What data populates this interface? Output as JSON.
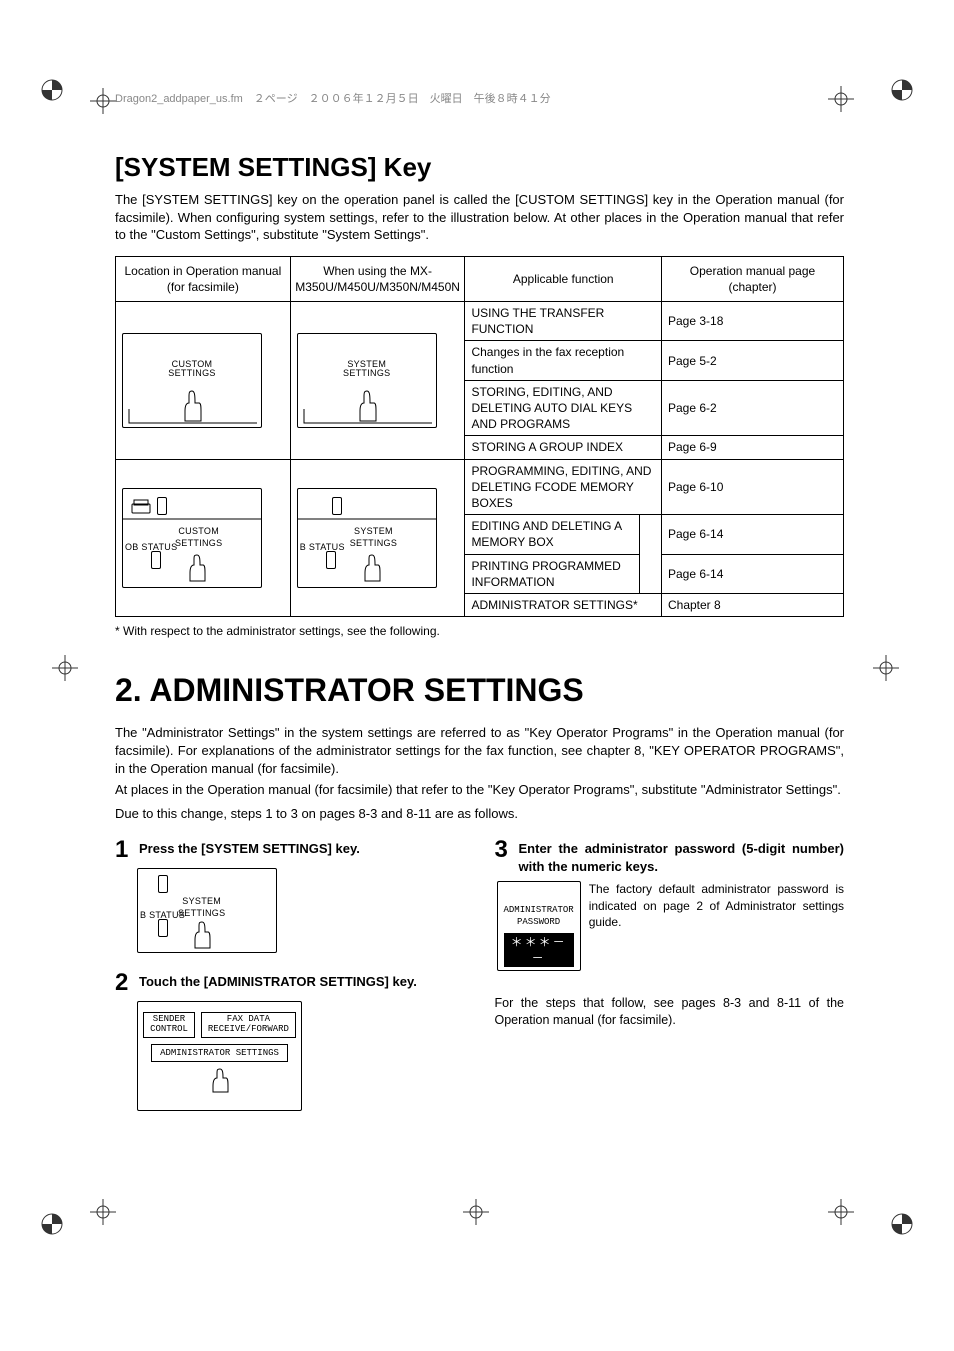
{
  "header_marker": "Dragon2_addpaper_us.fm　２ページ　２００６年１２月５日　火曜日　午後８時４１分",
  "section1": {
    "title": "[SYSTEM SETTINGS] Key",
    "body": "The [SYSTEM SETTINGS] key on the operation panel is called the [CUSTOM SETTINGS] key in the Operation manual (for facsimile). When configuring system settings, refer to the illustration below. At other places in the Operation manual that refer to the \"Custom Settings\", substitute \"System Settings\"."
  },
  "table": {
    "headers": [
      "Location in Operation manual (for facsimile)",
      "When using the MX-M350U/M450U/M350N/M450N",
      "Applicable function",
      "Operation manual page (chapter)"
    ],
    "col1_labels": {
      "top": "CUSTOM\nSETTINGS",
      "bottom_top": "CUSTOM",
      "bottom_sub": "SETTINGS",
      "edge": "OB STATUS"
    },
    "col2_labels": {
      "top": "SYSTEM\nSETTINGS",
      "bottom_top": "SYSTEM",
      "bottom_sub": "SETTINGS",
      "edge": "B STATUS"
    },
    "rows": [
      {
        "func": "USING THE TRANSFER FUNCTION",
        "page": "Page 3-18"
      },
      {
        "func": "Changes in the fax reception function",
        "page": "Page 5-2"
      },
      {
        "func": "STORING, EDITING, AND DELETING AUTO DIAL KEYS AND PROGRAMS",
        "page": "Page 6-2"
      },
      {
        "func": "STORING A GROUP INDEX",
        "page": "Page 6-9"
      },
      {
        "func": "PROGRAMMING, EDITING, AND DELETING FCODE MEMORY BOXES",
        "page": "Page 6-10"
      },
      {
        "func": "EDITING AND DELETING A MEMORY BOX",
        "page": "Page 6-14"
      },
      {
        "func": "PRINTING PROGRAMMED INFORMATION",
        "page": "Page 6-14"
      },
      {
        "func": "ADMINISTRATOR SETTINGS*",
        "page": "Chapter 8"
      }
    ],
    "footnote": "* With respect to the administrator settings, see the following."
  },
  "section2": {
    "title": "2. ADMINISTRATOR SETTINGS",
    "body1": "The \"Administrator Settings\" in the system settings are referred to as \"Key Operator Programs\" in the Operation manual (for facsimile). For explanations of the administrator settings for the fax function, see chapter 8, \"KEY OPERATOR PROGRAMS\", in the Operation manual (for facsimile).",
    "body2": "At places in the Operation manual (for facsimile) that refer to the \"Key Operator Programs\", substitute \"Administrator Settings\".",
    "body3": "Due to this change, steps 1 to 3 on pages 8-3 and 8-11 are as follows."
  },
  "steps": {
    "s1": {
      "num": "1",
      "text": "Press the [SYSTEM SETTINGS] key.",
      "illust_top": "SYSTEM",
      "illust_sub": "SETTINGS",
      "edge": "B STATUS"
    },
    "s2": {
      "num": "2",
      "text": "Touch the [ADMINISTRATOR SETTINGS] key.",
      "btn1": "SENDER CONTROL",
      "btn2_line1": "FAX DATA",
      "btn2_line2": "RECEIVE/FORWARD",
      "btn3": "ADMINISTRATOR SETTINGS"
    },
    "s3": {
      "num": "3",
      "text": "Enter the administrator password (5-digit number) with the numeric keys.",
      "pwd_label": "ADMINISTRATOR PASSWORD",
      "pwd_value": "＊＊＊－－",
      "explain": "The factory default administrator password is indicated on page 2 of Administrator settings guide.",
      "after": "For the steps that follow, see pages 8-3 and 8-11 of the Operation manual (for facsimile)."
    }
  }
}
